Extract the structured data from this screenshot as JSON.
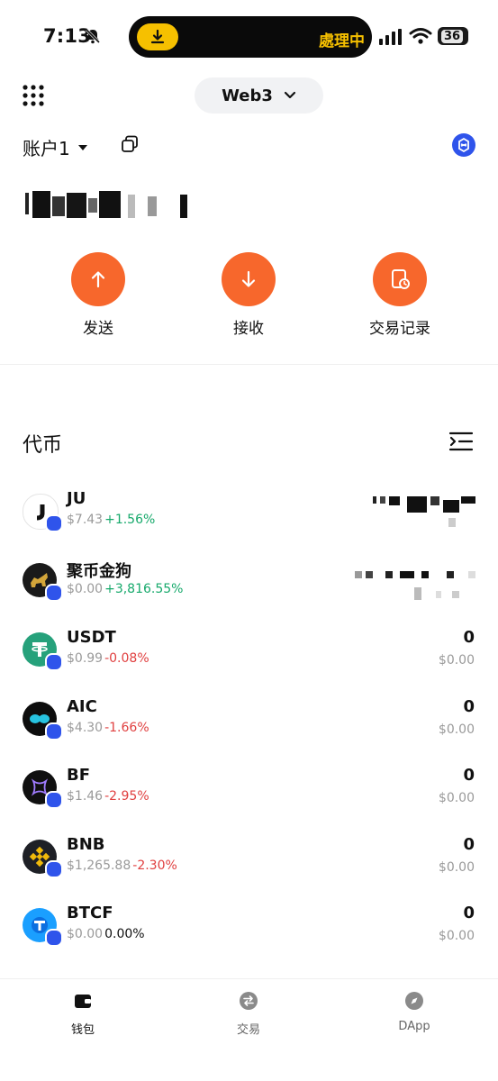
{
  "status_bar": {
    "time": "7:13",
    "processing_label": "處理中",
    "battery": "36"
  },
  "header": {
    "network_label": "Web3",
    "account_label": "账户1"
  },
  "actions": [
    {
      "label": "发送",
      "icon": "arrow-up-icon"
    },
    {
      "label": "接收",
      "icon": "arrow-down-icon"
    },
    {
      "label": "交易记录",
      "icon": "history-icon"
    }
  ],
  "tokens_title": "代币",
  "tokens": [
    {
      "name": "JU",
      "price": "$7.43",
      "change": "+1.56%",
      "trend": "pos",
      "amount": "",
      "value": "",
      "icon_color": "#ffffff"
    },
    {
      "name": "聚币金狗",
      "price": "$0.00",
      "change": "+3,816.55%",
      "trend": "pos",
      "amount": "",
      "value": "",
      "icon_color": "#1a1a1a"
    },
    {
      "name": "USDT",
      "price": "$0.99",
      "change": "-0.08%",
      "trend": "neg",
      "amount": "0",
      "value": "$0.00",
      "icon_color": "#26a17b"
    },
    {
      "name": "AIC",
      "price": "$4.30",
      "change": "-1.66%",
      "trend": "neg",
      "amount": "0",
      "value": "$0.00",
      "icon_color": "#0d0d0d"
    },
    {
      "name": "BF",
      "price": "$1.46",
      "change": "-2.95%",
      "trend": "neg",
      "amount": "0",
      "value": "$0.00",
      "icon_color": "#101010"
    },
    {
      "name": "BNB",
      "price": "$1,265.88",
      "change": "-2.30%",
      "trend": "neg",
      "amount": "0",
      "value": "$0.00",
      "icon_color": "#1e2026"
    },
    {
      "name": "BTCF",
      "price": "$0.00",
      "change": "0.00%",
      "trend": "zero",
      "amount": "0",
      "value": "$0.00",
      "icon_color": "#1a9fff"
    }
  ],
  "bottom_nav": [
    {
      "label": "钱包",
      "icon": "wallet-icon",
      "active": true
    },
    {
      "label": "交易",
      "icon": "swap-icon",
      "active": false
    },
    {
      "label": "DApp",
      "icon": "compass-icon",
      "active": false
    }
  ],
  "colors": {
    "accent": "#f7672c",
    "positive": "#16a96b",
    "negative": "#e04040",
    "chain_badge": "#2f54eb"
  }
}
